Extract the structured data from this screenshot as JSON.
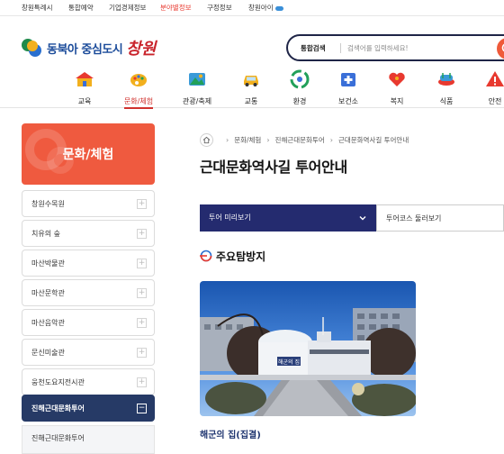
{
  "topbar": {
    "links": [
      "창원특례시",
      "통합예약",
      "기업경제정보",
      "분야별정보",
      "구정정보",
      "창원아이"
    ],
    "active_index": 3
  },
  "logo": {
    "text": "동북아 중심도시",
    "script": "창원"
  },
  "search": {
    "label": "통합검색",
    "placeholder": "검색어를 입력하세요!"
  },
  "nav": {
    "items": [
      {
        "label": "교육",
        "icon": "school-icon"
      },
      {
        "label": "문화/체험",
        "icon": "culture-palette-icon"
      },
      {
        "label": "관광/축제",
        "icon": "tourism-icon"
      },
      {
        "label": "교통",
        "icon": "car-icon"
      },
      {
        "label": "환경",
        "icon": "recycle-icon"
      },
      {
        "label": "보건소",
        "icon": "health-center-icon"
      },
      {
        "label": "복지",
        "icon": "welfare-heart-icon"
      },
      {
        "label": "식품",
        "icon": "food-icon"
      },
      {
        "label": "안전",
        "icon": "warning-icon"
      }
    ],
    "active_index": 1
  },
  "sidebar": {
    "title": "문화/체험",
    "items": [
      {
        "label": "창원수목원",
        "active": false
      },
      {
        "label": "치유의 숲",
        "active": false
      },
      {
        "label": "마산박물관",
        "active": false
      },
      {
        "label": "마산문학관",
        "active": false
      },
      {
        "label": "마산음악관",
        "active": false
      },
      {
        "label": "문신미술관",
        "active": false
      },
      {
        "label": "웅천도요지전시관",
        "active": false
      },
      {
        "label": "진해근대문화투어",
        "active": true
      }
    ],
    "sub_item": "진해근대문화투어",
    "active_toggle": "−",
    "inactive_toggle": "+"
  },
  "breadcrumb": [
    "문화/체험",
    "진해근대문화투어",
    "근대문화역사길 투어안내"
  ],
  "page_title": "근대문화역사길 투어안내",
  "tabs": [
    {
      "label": "투어 미리보기",
      "active": true
    },
    {
      "label": "투어코스 둘러보기",
      "active": false
    }
  ],
  "section_title": "주요탐방지",
  "photo": {
    "sign_text": "해군의 집"
  },
  "photo_caption": "해군의 집(집결)",
  "colors": {
    "brand_orange": "#ef5a3f",
    "sidebar_active": "#263a66",
    "tab_active": "#242b6f",
    "nav_active": "#d0312d"
  }
}
